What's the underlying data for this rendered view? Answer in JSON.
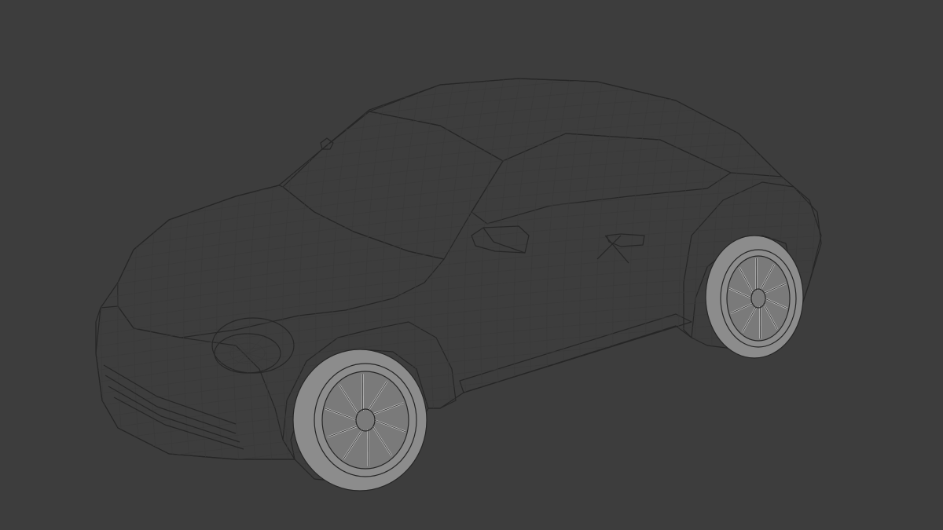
{
  "viewport": {
    "background_color": "#3d3d3d",
    "mode": "wireframe-overlay",
    "object": "car-mesh"
  },
  "colors": {
    "mesh_surface": "#a3a3a3",
    "mesh_edges": "#262626",
    "wire": "#3a3a3a"
  }
}
